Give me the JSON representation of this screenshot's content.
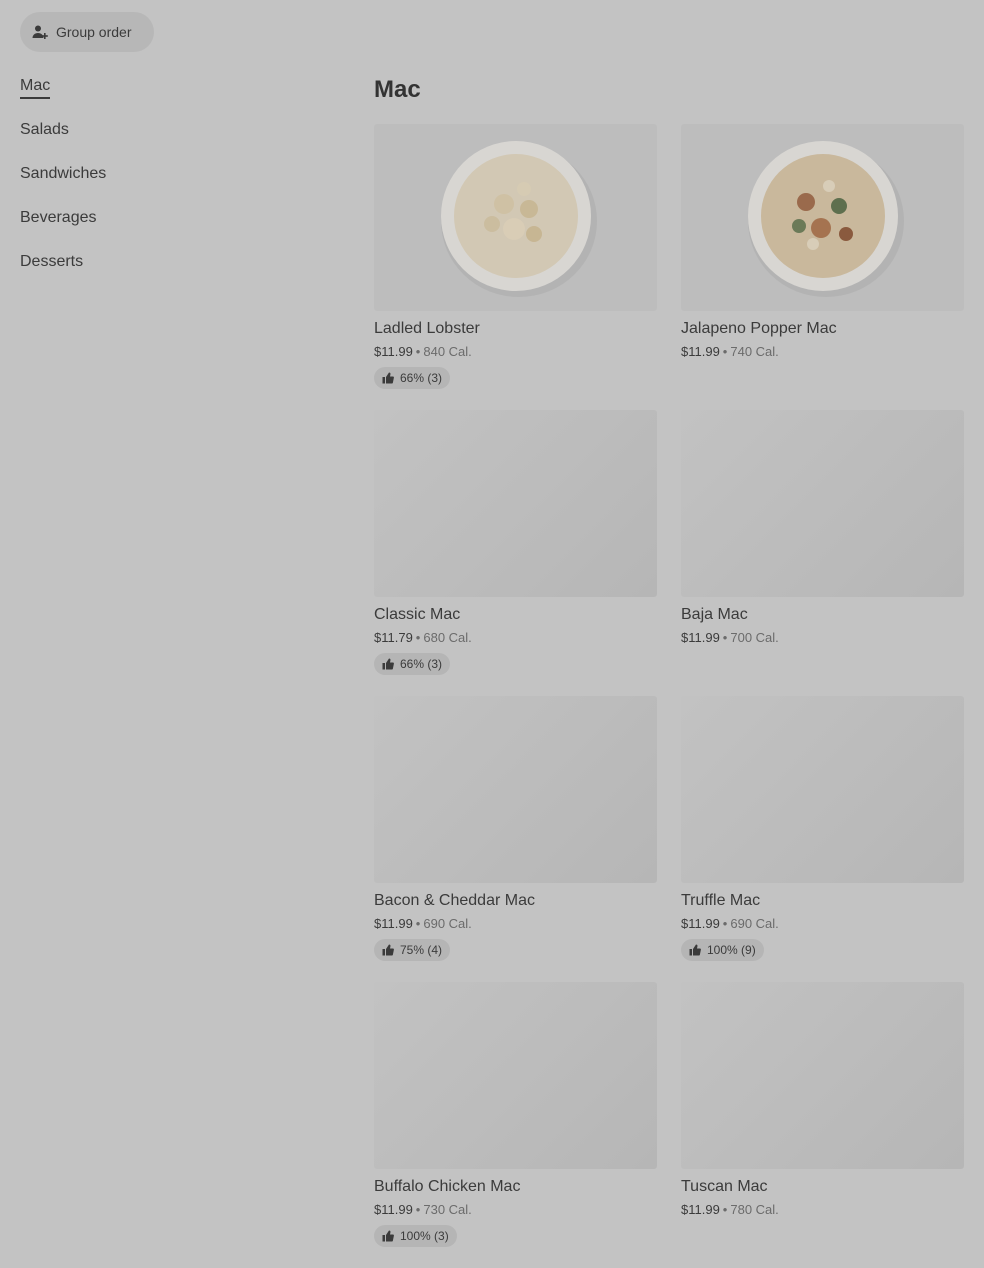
{
  "header": {
    "group_order_label": "Group order"
  },
  "nav": [
    {
      "label": "Mac",
      "active": true
    },
    {
      "label": "Salads"
    },
    {
      "label": "Sandwiches"
    },
    {
      "label": "Beverages"
    },
    {
      "label": "Desserts"
    }
  ],
  "section": {
    "title": "Mac"
  },
  "items": [
    {
      "name": "Ladled Lobster",
      "price": "$11.99",
      "separator": "•",
      "calories": "840 Cal.",
      "rating": "66% (3)"
    },
    {
      "name": "Jalapeno Popper Mac",
      "price": "$11.99",
      "separator": "•",
      "calories": "740 Cal."
    },
    {
      "name": "Classic Mac",
      "price": "$11.79",
      "separator": "•",
      "calories": "680 Cal.",
      "rating": "66% (3)"
    },
    {
      "name": "Baja Mac",
      "price": "$11.99",
      "separator": "•",
      "calories": "700 Cal."
    },
    {
      "name": "Bacon & Cheddar Mac",
      "price": "$11.99",
      "separator": "•",
      "calories": "690 Cal.",
      "rating": "75% (4)"
    },
    {
      "name": "Truffle Mac",
      "price": "$11.99",
      "separator": "•",
      "calories": "690 Cal.",
      "rating": "100% (9)"
    },
    {
      "name": "Buffalo Chicken Mac",
      "price": "$11.99",
      "separator": "•",
      "calories": "730 Cal.",
      "rating": "100% (3)"
    },
    {
      "name": "Tuscan Mac",
      "price": "$11.99",
      "separator": "•",
      "calories": "780 Cal."
    }
  ],
  "icons": {
    "group_order": "add-person-icon",
    "rating": "thumbs-up-icon"
  }
}
